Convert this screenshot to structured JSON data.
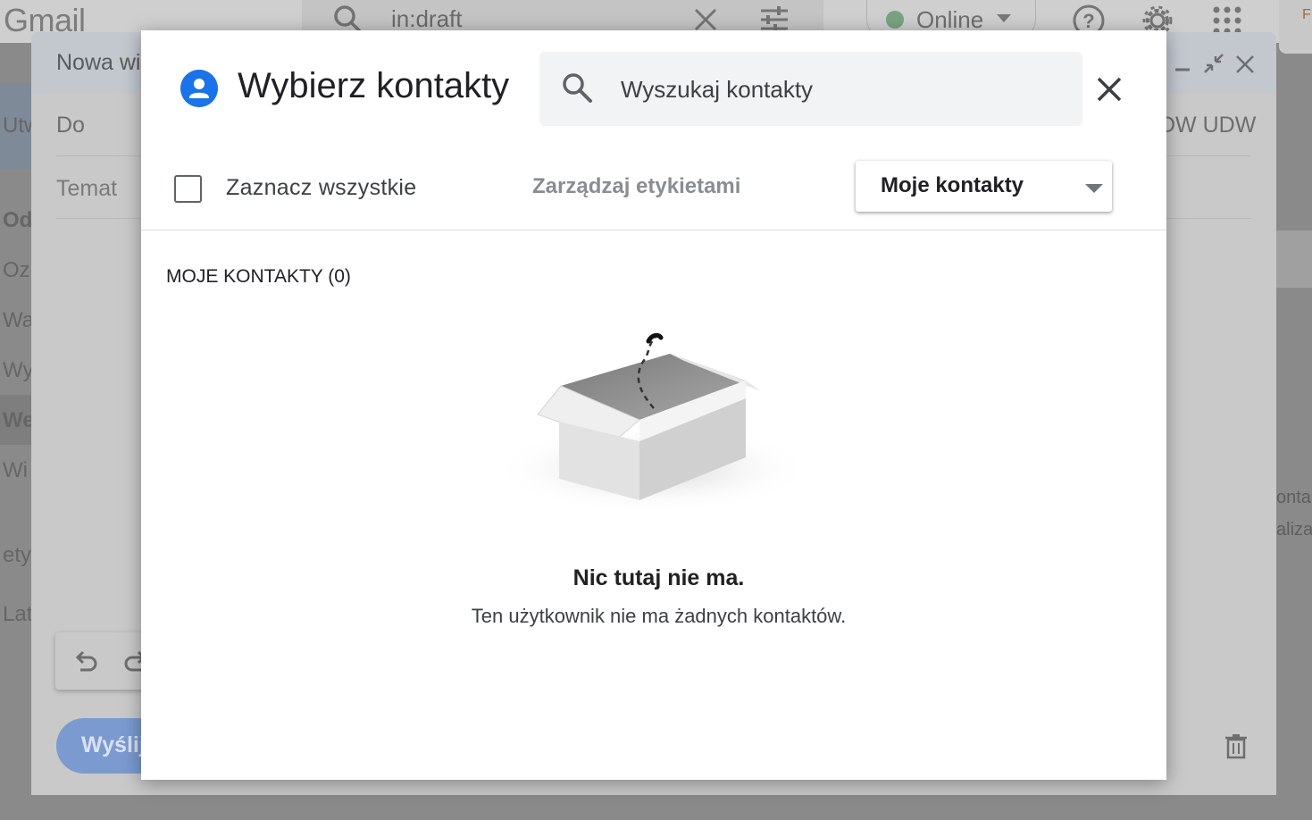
{
  "gmail": {
    "logo": "Gmail",
    "search_query": "in:draft",
    "status_label": "Online",
    "account_initial": "F",
    "sidebar_items": [
      "Utw",
      "Od",
      "Oz",
      "Wa",
      "Wy",
      "We",
      "Wi",
      "ety",
      "Lat"
    ],
    "right_texts": [
      "onta:",
      "aliza"
    ]
  },
  "compose": {
    "title": "Nowa wi",
    "to_label": "Do",
    "cc_bcc_label": "DW UDW",
    "subject_placeholder": "Temat",
    "send_label": "Wyślij"
  },
  "dialog": {
    "title": "Wybierz kontakty",
    "search_placeholder": "Wyszukaj kontakty",
    "select_all_label": "Zaznacz wszystkie",
    "manage_labels": "Zarządzaj etykietami",
    "dropdown_value": "Moje kontakty",
    "section_header": "MOJE KONTAKTY (0)",
    "empty_title": "Nic tutaj nie ma.",
    "empty_subtitle": "Ten użytkownik nie ma żadnych kontaktów."
  },
  "colors": {
    "accent": "#1a73e8",
    "status_online": "#34a853"
  },
  "icons": [
    "search-icon",
    "close-icon",
    "tune-icon",
    "help-icon",
    "settings-icon",
    "apps-icon",
    "minimize-icon",
    "expand-icon",
    "undo-icon",
    "redo-icon",
    "trash-icon",
    "contacts-icon",
    "empty-box-illustration"
  ]
}
